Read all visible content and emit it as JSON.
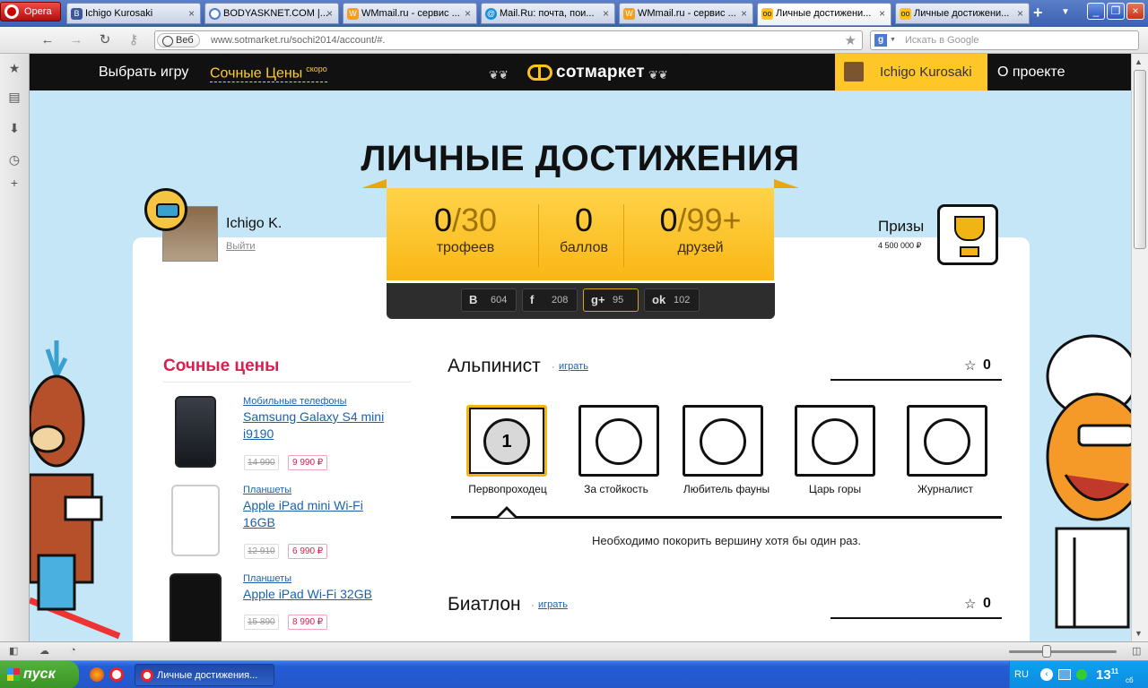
{
  "browser": {
    "menu_label": "Opera",
    "tabs": [
      {
        "label": "Ichigo Kurosaki",
        "color": "#3b5998",
        "icon": "vk-icon"
      },
      {
        "label": "BODYASKNET.COM |...",
        "color": "#4a7bd3",
        "icon": "loading-icon"
      },
      {
        "label": "WMmail.ru - сервис ...",
        "color": "#f0a020",
        "icon": "wmmail-icon"
      },
      {
        "label": "Mail.Ru: почта, пои...",
        "color": "#168de2",
        "icon": "mailru-icon"
      },
      {
        "label": "WMmail.ru - сервис ...",
        "color": "#f0a020",
        "icon": "wmmail-icon"
      },
      {
        "label": "Личные достижени...",
        "color": "#ffc21a",
        "icon": "sotmarket-icon"
      },
      {
        "label": "Личные достижени...",
        "color": "#ffc21a",
        "icon": "sotmarket-icon"
      }
    ],
    "address_badge": "Веб",
    "url": "www.sotmarket.ru/sochi2014/account/#.",
    "search_placeholder": "Искать в Google",
    "search_engine_letter": "g"
  },
  "site": {
    "nav_choose_game": "Выбрать игру",
    "nav_juicy": "Сочные Цены",
    "nav_juicy_badge": "скоро",
    "logo_text": "сотмаркет",
    "header_user": "Ichigo Kurosaki",
    "nav_about": "О проекте"
  },
  "main": {
    "title": "ЛИЧНЫЕ ДОСТИЖЕНИЯ",
    "username": "Ichigo K.",
    "logout": "Выйти",
    "prizes_label": "Призы",
    "prizes_sum": "4 500 000 ₽"
  },
  "stats": [
    {
      "value": "0",
      "of": "/30",
      "label": "трофеев"
    },
    {
      "value": "0",
      "of": "",
      "label": "баллов"
    },
    {
      "value": "0",
      "of": "/99+",
      "label": "друзей"
    }
  ],
  "social": [
    {
      "icon_label": "B",
      "count": "604",
      "name": "vk-icon"
    },
    {
      "icon_label": "f",
      "count": "208",
      "name": "facebook-icon"
    },
    {
      "icon_label": "g+",
      "count": "95",
      "name": "google-plus-icon"
    },
    {
      "icon_label": "ok",
      "count": "102",
      "name": "odnoklassniki-icon"
    }
  ],
  "juicy_prices": {
    "title": "Сочные цены",
    "products": [
      {
        "category": "Мобильные телефоны",
        "name": "Samsung Galaxy S4 mini i9190",
        "old_price": "14 990",
        "new_price": "9 990 ₽"
      },
      {
        "category": "Планшеты",
        "name": "Apple iPad mini Wi-Fi 16GB",
        "old_price": "12 910",
        "new_price": "6 990 ₽"
      },
      {
        "category": "Планшеты",
        "name": "Apple iPad Wi-Fi 32GB",
        "old_price": "15 890",
        "new_price": "8 990 ₽"
      }
    ]
  },
  "sections": [
    {
      "title": "Альпинист",
      "play": "играть",
      "count": "0"
    },
    {
      "title": "Биатлон",
      "play": "играть",
      "count": "0"
    }
  ],
  "achievements": [
    {
      "label": "Первопроходец",
      "selected": true,
      "medal_number": "1"
    },
    {
      "label": "За стойкость",
      "selected": false
    },
    {
      "label": "Любитель фауны",
      "selected": false
    },
    {
      "label": "Царь горы",
      "selected": false
    },
    {
      "label": "Журналист",
      "selected": false
    }
  ],
  "achievement_desc": "Необходимо покорить вершину хотя бы один раз.",
  "taskbar": {
    "start": "пуск",
    "task_label": "Личные достижения...",
    "lang": "RU",
    "time": "13",
    "time_small": "11",
    "time_unit": "сб"
  },
  "colors": {
    "accent_yellow": "#ffc627",
    "juicy_pink": "#d8204f",
    "link_blue": "#1a62b0",
    "page_bg": "#c5e6f7"
  }
}
